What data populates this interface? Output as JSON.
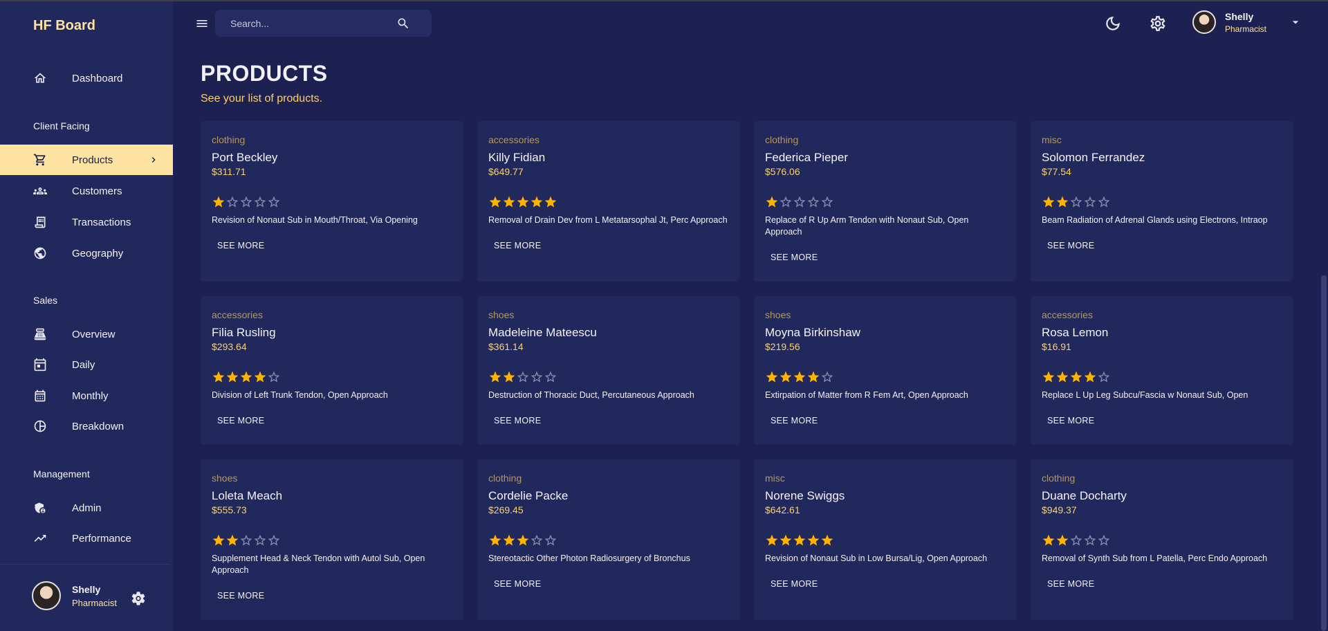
{
  "app": {
    "title": "HF Board"
  },
  "sidebar": {
    "items": [
      {
        "label": "Dashboard",
        "icon": "home-icon"
      },
      {
        "section": "Client Facing"
      },
      {
        "label": "Products",
        "icon": "cart-icon",
        "active": true
      },
      {
        "label": "Customers",
        "icon": "groups-icon"
      },
      {
        "label": "Transactions",
        "icon": "receipt-icon"
      },
      {
        "label": "Geography",
        "icon": "globe-icon"
      },
      {
        "section": "Sales"
      },
      {
        "label": "Overview",
        "icon": "point-of-sale-icon"
      },
      {
        "label": "Daily",
        "icon": "calendar-today-icon"
      },
      {
        "label": "Monthly",
        "icon": "calendar-month-icon"
      },
      {
        "label": "Breakdown",
        "icon": "pie-chart-icon"
      },
      {
        "section": "Management"
      },
      {
        "label": "Admin",
        "icon": "admin-icon"
      },
      {
        "label": "Performance",
        "icon": "trending-up-icon"
      }
    ],
    "user": {
      "name": "Shelly",
      "role": "Pharmacist"
    }
  },
  "topbar": {
    "search_placeholder": "Search...",
    "user": {
      "name": "Shelly",
      "role": "Pharmacist"
    }
  },
  "header": {
    "title": "PRODUCTS",
    "subtitle": "See your list of products."
  },
  "see_more_label": "SEE MORE",
  "colors": {
    "accent": "#ffd166",
    "active_bg": "#ffe3a3",
    "background": "#1c2152",
    "panel": "#21295c",
    "star": "#ffb300"
  },
  "products": [
    {
      "category": "clothing",
      "name": "Port Beckley",
      "price": "$311.71",
      "rating": 1,
      "description": "Revision of Nonaut Sub in Mouth/Throat, Via Opening"
    },
    {
      "category": "accessories",
      "name": "Killy Fidian",
      "price": "$649.77",
      "rating": 5,
      "description": "Removal of Drain Dev from L Metatarsophal Jt, Perc Approach"
    },
    {
      "category": "clothing",
      "name": "Federica Pieper",
      "price": "$576.06",
      "rating": 1,
      "description": "Replace of R Up Arm Tendon with Nonaut Sub, Open Approach"
    },
    {
      "category": "misc",
      "name": "Solomon Ferrandez",
      "price": "$77.54",
      "rating": 2,
      "description": "Beam Radiation of Adrenal Glands using Electrons, Intraop"
    },
    {
      "category": "accessories",
      "name": "Filia Rusling",
      "price": "$293.64",
      "rating": 4,
      "description": "Division of Left Trunk Tendon, Open Approach"
    },
    {
      "category": "shoes",
      "name": "Madeleine Mateescu",
      "price": "$361.14",
      "rating": 2,
      "description": "Destruction of Thoracic Duct, Percutaneous Approach"
    },
    {
      "category": "shoes",
      "name": "Moyna Birkinshaw",
      "price": "$219.56",
      "rating": 4,
      "description": "Extirpation of Matter from R Fem Art, Open Approach"
    },
    {
      "category": "accessories",
      "name": "Rosa Lemon",
      "price": "$16.91",
      "rating": 4,
      "description": "Replace L Up Leg Subcu/Fascia w Nonaut Sub, Open"
    },
    {
      "category": "shoes",
      "name": "Loleta Meach",
      "price": "$555.73",
      "rating": 2,
      "description": "Supplement Head & Neck Tendon with Autol Sub, Open Approach"
    },
    {
      "category": "clothing",
      "name": "Cordelie Packe",
      "price": "$269.45",
      "rating": 3,
      "description": "Stereotactic Other Photon Radiosurgery of Bronchus"
    },
    {
      "category": "misc",
      "name": "Norene Swiggs",
      "price": "$642.61",
      "rating": 5,
      "description": "Revision of Nonaut Sub in Low Bursa/Lig, Open Approach"
    },
    {
      "category": "clothing",
      "name": "Duane Docharty",
      "price": "$949.37",
      "rating": 2,
      "description": "Removal of Synth Sub from L Patella, Perc Endo Approach"
    }
  ]
}
